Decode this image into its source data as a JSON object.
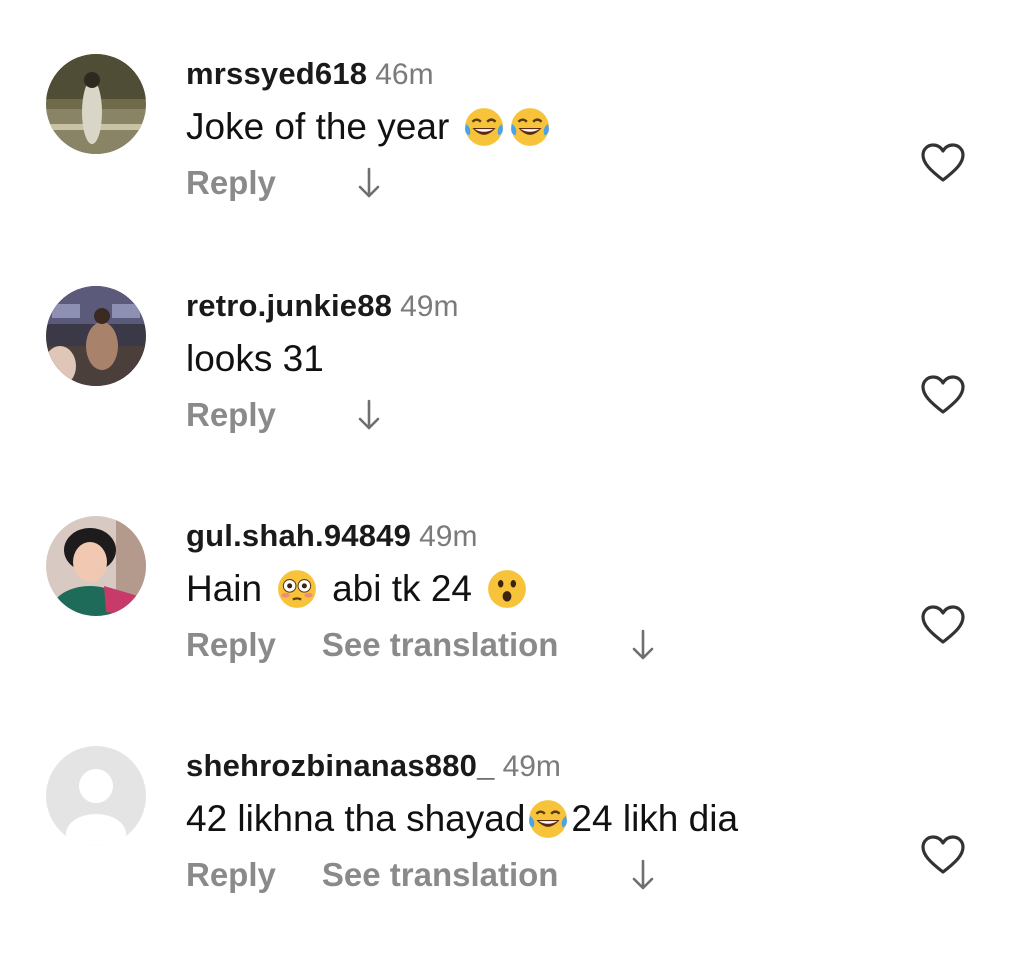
{
  "comments": [
    {
      "username": "mrssyed618",
      "time": "46m",
      "text_before": "Joke of the year",
      "text_after": "",
      "reply_label": "Reply",
      "see_translation_label": ""
    },
    {
      "username": "retro.junkie88",
      "time": "49m",
      "text_before": "looks 31",
      "text_after": "",
      "reply_label": "Reply",
      "see_translation_label": ""
    },
    {
      "username": "gul.shah.94849",
      "time": "49m",
      "text_before": "Hain",
      "text_middle": "abi tk 24",
      "text_after": "",
      "reply_label": "Reply",
      "see_translation_label": "See translation"
    },
    {
      "username": "shehrozbinanas880_",
      "time": "49m",
      "text_before": "42 likhna tha shayad",
      "text_after": "24 likh dia",
      "reply_label": "Reply",
      "see_translation_label": "See translation"
    }
  ],
  "icons": {
    "like": "heart-outline-icon",
    "replies": "arrow-down-icon",
    "laughing": "face-with-tears-of-joy-emoji",
    "flushed": "flushed-face-emoji",
    "surprised": "surprised-face-emoji"
  },
  "colors": {
    "username": "#1a1a1a",
    "secondary_text": "#7b7b7b",
    "action_text": "#8a8a8a",
    "emoji_yellow": "#f7c33a"
  }
}
